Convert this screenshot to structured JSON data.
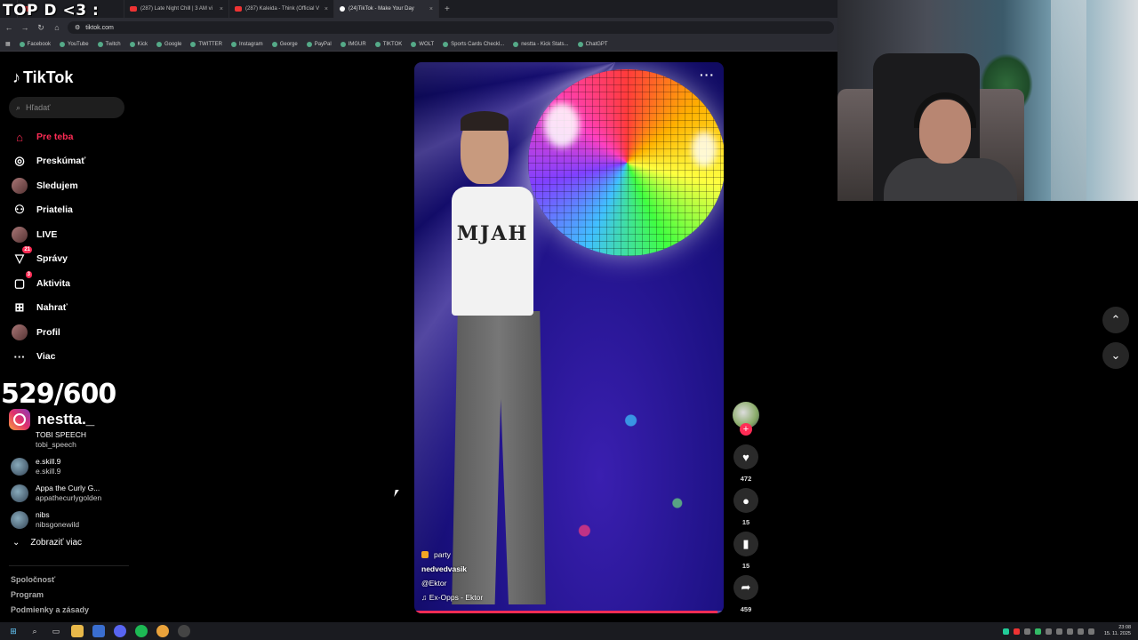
{
  "overlay": {
    "title": "TOP D <3 :",
    "counter": "529/600",
    "instagram_handle": "nestta._"
  },
  "browser": {
    "tabs": [
      {
        "label": "(287) Late Night Chill | 3 AM vi",
        "active": false
      },
      {
        "label": "(287) Kaleida - Think (Official V",
        "active": false
      },
      {
        "label": "(24)TikTok - Make Your Day",
        "active": true
      }
    ],
    "url": "tiktok.com",
    "bookmarks": [
      "Facebook",
      "YouTube",
      "Twitch",
      "Kick",
      "Google",
      "TWITTER",
      "Instagram",
      "George",
      "PayPal",
      "IMGUR",
      "TIKTOK",
      "WOLT",
      "Sports Cards Checkl...",
      "nestta - Kick Stats...",
      "ChatGPT"
    ]
  },
  "sidebar": {
    "logo": "TikTok",
    "search_placeholder": "Hľadať",
    "nav": [
      {
        "label": "Pre teba",
        "icon": "home-icon"
      },
      {
        "label": "Preskúmať",
        "icon": "compass-icon"
      },
      {
        "label": "Sledujem",
        "icon": "following-icon"
      },
      {
        "label": "Priatelia",
        "icon": "friends-icon"
      },
      {
        "label": "LIVE",
        "icon": "live-icon"
      },
      {
        "label": "Správy",
        "icon": "messages-icon",
        "badge": "21"
      },
      {
        "label": "Aktivita",
        "icon": "activity-icon",
        "badge": "3"
      },
      {
        "label": "Nahrať",
        "icon": "upload-icon"
      },
      {
        "label": "Profil",
        "icon": "profile-icon"
      },
      {
        "label": "Viac",
        "icon": "more-icon"
      }
    ],
    "following": [
      {
        "name": "TOBI SPEECH",
        "handle": "tobi_speech"
      },
      {
        "name": "e.skill.9",
        "handle": "e.skill.9"
      },
      {
        "name": "Appa the Curly G...",
        "handle": "appathecurlygolden"
      },
      {
        "name": "nibs",
        "handle": "nibsgonewild"
      }
    ],
    "show_more": "Zobraziť viac",
    "footer": [
      "Spoločnosť",
      "Program",
      "Podmienky a zásady"
    ]
  },
  "video": {
    "shirt_text": "MJAH",
    "tag": "party",
    "author": "nedvedvasik",
    "mention": "@Ektor",
    "sound": "Ex-Opps - Ektor",
    "progress": 0.98
  },
  "actions": {
    "likes": "472",
    "comments": "15",
    "saves": "15",
    "shares": "459"
  },
  "taskbar": {
    "time": "23:08",
    "date": "15. 11. 2025"
  },
  "colors": {
    "accent": "#fe2c55",
    "background": "#000000"
  }
}
